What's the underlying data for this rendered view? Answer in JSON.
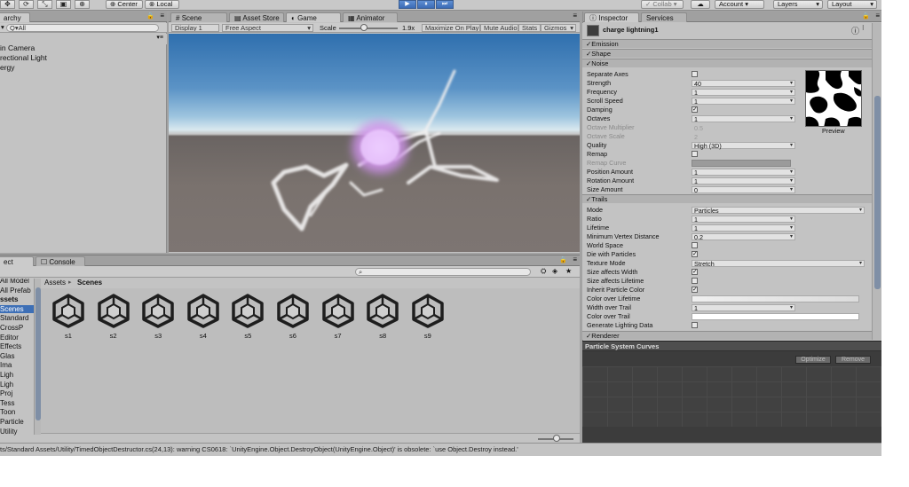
{
  "toolbar": {
    "pivot_label": "Center",
    "space_label": "Local",
    "collab_label": "Collab ▾",
    "account_label": "Account",
    "layers_label": "Layers",
    "layout_label": "Layout",
    "play_icon": "▶",
    "pause_icon": "⏸",
    "step_icon": "⏭"
  },
  "hierarchy": {
    "tab_label": "archy",
    "search_placeholder": "Q▾All",
    "items": [
      "in Camera",
      "rectional Light",
      "ergy"
    ]
  },
  "scene_tabs": {
    "scene": "Scene",
    "asset_store": "Asset Store",
    "game": "Game",
    "animator": "Animator"
  },
  "game_bar": {
    "display": "Display 1",
    "aspect": "Free Aspect",
    "scale_label": "Scale",
    "scale_value": "1.9x",
    "maximize": "Maximize On Play",
    "mute": "Mute Audio",
    "stats": "Stats",
    "gizmos": "Gizmos"
  },
  "inspector": {
    "tab_label": "Inspector",
    "services_label": "Services",
    "object_name": "charge lightning1",
    "modules_top": [
      "Emission",
      "Shape",
      "Noise"
    ],
    "noise_props": [
      {
        "label": "Separate Axes",
        "type": "check",
        "value": ""
      },
      {
        "label": "Strength",
        "type": "value",
        "value": "40"
      },
      {
        "label": "Frequency",
        "type": "value",
        "value": "1"
      },
      {
        "label": "Scroll Speed",
        "type": "value",
        "value": "1"
      },
      {
        "label": "Damping",
        "type": "check",
        "value": "✓"
      },
      {
        "label": "Octaves",
        "type": "value",
        "value": "1"
      },
      {
        "label": "Octave Multiplier",
        "type": "dim",
        "value": "0.5"
      },
      {
        "label": "Octave Scale",
        "type": "dim",
        "value": "2"
      },
      {
        "label": "Quality",
        "type": "value",
        "value": "High (3D)"
      },
      {
        "label": "Remap",
        "type": "check",
        "value": ""
      },
      {
        "label": "Remap Curve",
        "type": "dim",
        "value": ""
      },
      {
        "label": "Position Amount",
        "type": "value",
        "value": "1"
      },
      {
        "label": "Rotation Amount",
        "type": "value",
        "value": "1"
      },
      {
        "label": "Size Amount",
        "type": "value",
        "value": "0"
      }
    ],
    "preview_label": "Preview",
    "trails_label": "Trails",
    "trails_props": [
      {
        "label": "Mode",
        "type": "value",
        "value": "Particles"
      },
      {
        "label": "Ratio",
        "type": "value",
        "value": "1"
      },
      {
        "label": "Lifetime",
        "type": "value",
        "value": "1"
      },
      {
        "label": "Minimum Vertex Distance",
        "type": "value",
        "value": "0.2"
      },
      {
        "label": "World Space",
        "type": "check",
        "value": ""
      },
      {
        "label": "Die with Particles",
        "type": "check",
        "value": "✓"
      },
      {
        "label": "Texture Mode",
        "type": "value",
        "value": "Stretch"
      },
      {
        "label": "Size affects Width",
        "type": "check",
        "value": "✓"
      },
      {
        "label": "Size affects Lifetime",
        "type": "check",
        "value": ""
      },
      {
        "label": "Inherit Particle Color",
        "type": "check",
        "value": "✓"
      },
      {
        "label": "Color over Lifetime",
        "type": "value",
        "value": ""
      },
      {
        "label": "Width over Trail",
        "type": "value",
        "value": "1"
      },
      {
        "label": "Color over Trail",
        "type": "value",
        "value": ""
      },
      {
        "label": "Generate Lighting Data",
        "type": "check",
        "value": ""
      }
    ],
    "renderer_label": "Renderer"
  },
  "curves": {
    "title": "Particle System Curves",
    "optimize": "Optimize",
    "remove": "Remove"
  },
  "project": {
    "tab_label": "ect",
    "console_label": "Console",
    "tree": [
      "All Model",
      "All Prefab",
      "ssets",
      "Scenes",
      "Standard",
      "CrossP",
      "Editor",
      "Effects",
      "Glas",
      "Ima",
      "Ligh",
      "Ligh",
      "Proj",
      "Tess",
      "Toon",
      "Particle",
      "Utility"
    ],
    "breadcrumb_root": "Assets",
    "breadcrumb_sep": "▸",
    "breadcrumb_current": "Scenes",
    "assets": [
      "s1",
      "s2",
      "s3",
      "s4",
      "s5",
      "s6",
      "s7",
      "s8",
      "s9"
    ]
  },
  "status": {
    "message": "ts/Standard Assets/Utility/TimedObjectDestructor.cs(24,13): warning CS0618: `UnityEngine.Object.DestroyObject(UnityEngine.Object)' is obsolete: `use Object.Destroy instead.'"
  }
}
